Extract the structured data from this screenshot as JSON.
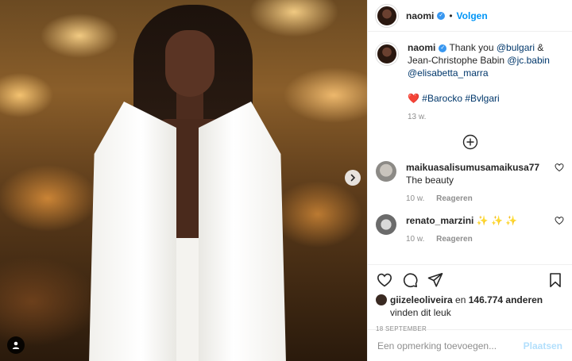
{
  "post": {
    "username": "naomi",
    "follow_label": "Volgen",
    "dot": "•"
  },
  "caption": {
    "username": "naomi",
    "text_1": "Thank you ",
    "mention_1": "@bulgari",
    "text_2": " & Jean-Christophe Babin ",
    "mention_2": "@jc.babin",
    "mention_3": "@elisabetta_marra",
    "heart": "❤️",
    "hashtags": "#Barocko #Bvlgari",
    "age": "13 w."
  },
  "comments": [
    {
      "username": "maikuasalisumusamaikusa77",
      "text": " The beauty",
      "age": "10 w.",
      "reply_label": "Reageren"
    },
    {
      "username": "renato_marzini",
      "text": " ✨ ✨ ✨",
      "age": "10 w.",
      "reply_label": "Reageren"
    }
  ],
  "likes": {
    "user": "giizeleoliveira",
    "text_1": " en ",
    "count": "146.774 anderen",
    "text_2": "vinden dit leuk"
  },
  "date": "18 SEPTEMBER",
  "comment_input": {
    "placeholder": "Een opmerking toevoegen...",
    "post_label": "Plaatsen"
  },
  "colors": {
    "accent": "#0095f6",
    "verified": "#3897f0",
    "post_disabled": "#b2dffc",
    "muted": "#8e8e8e"
  }
}
